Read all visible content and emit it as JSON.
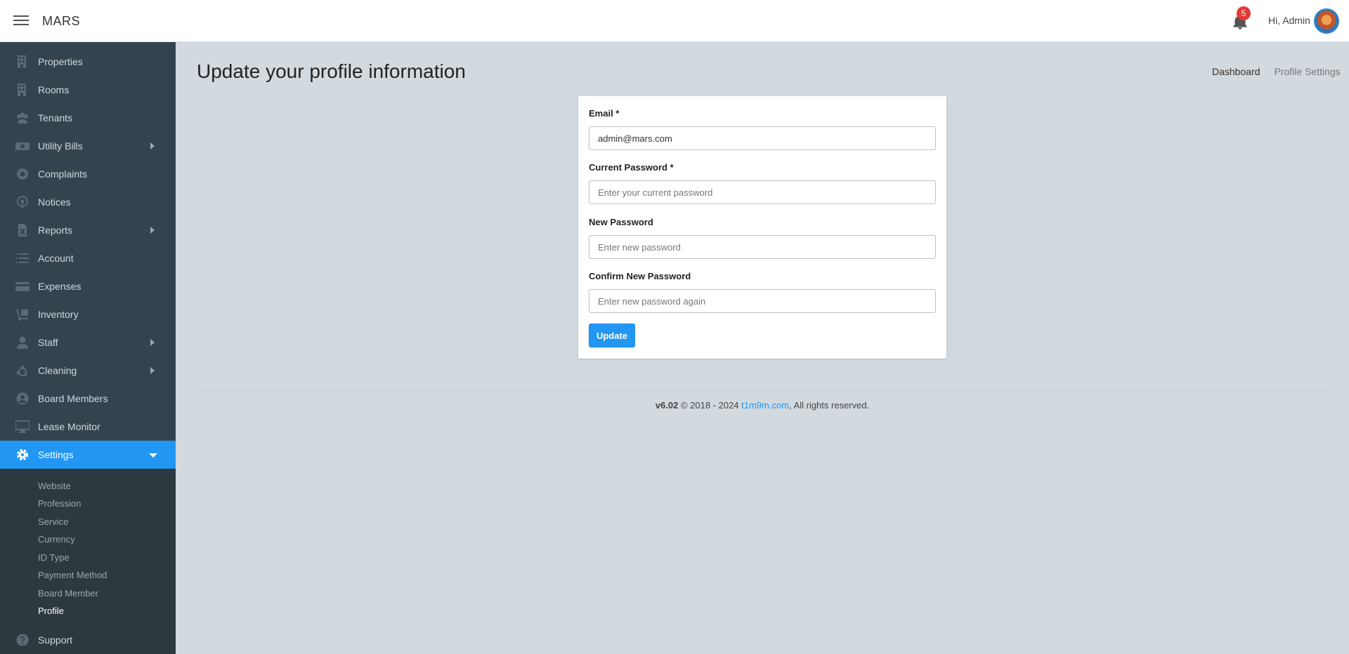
{
  "header": {
    "brand": "MARS",
    "notification_count": "5",
    "greeting": "Hi, Admin"
  },
  "sidebar": {
    "items": [
      {
        "label": "Properties",
        "icon": "building-icon"
      },
      {
        "label": "Rooms",
        "icon": "building-icon"
      },
      {
        "label": "Tenants",
        "icon": "users-icon"
      },
      {
        "label": "Utility Bills",
        "icon": "money-icon"
      },
      {
        "label": "Complaints",
        "icon": "lifebuoy-icon"
      },
      {
        "label": "Notices",
        "icon": "broadcast-icon"
      },
      {
        "label": "Reports",
        "icon": "excel-file-icon"
      },
      {
        "label": "Account",
        "icon": "list-icon"
      },
      {
        "label": "Expenses",
        "icon": "credit-card-icon"
      },
      {
        "label": "Inventory",
        "icon": "dolly-icon"
      },
      {
        "label": "Staff",
        "icon": "user-icon"
      },
      {
        "label": "Cleaning",
        "icon": "recycle-icon"
      },
      {
        "label": "Board Members",
        "icon": "user-circle-icon"
      },
      {
        "label": "Lease Monitor",
        "icon": "monitor-icon"
      },
      {
        "label": "Settings",
        "icon": "gear-icon"
      }
    ],
    "settings_submenu": [
      "Website",
      "Profession",
      "Service",
      "Currency",
      "ID Type",
      "Payment Method",
      "Board Member",
      "Profile"
    ],
    "support_label": "Support",
    "active_color": "#2196f3"
  },
  "main": {
    "title": "Update your profile information",
    "breadcrumb": [
      "Dashboard",
      "Profile Settings"
    ]
  },
  "form": {
    "email_label": "Email *",
    "email_value": "admin@mars.com",
    "current_password_label": "Current Password *",
    "current_password_placeholder": "Enter your current password",
    "new_password_label": "New Password",
    "new_password_placeholder": "Enter new password",
    "confirm_password_label": "Confirm New Password",
    "confirm_password_placeholder": "Enter new password again",
    "submit_label": "Update"
  },
  "footer": {
    "version": "v6.02",
    "copyright": " © 2018 - 2024 ",
    "link_text": "t1m9m.com",
    "rights": ", All rights reserved."
  }
}
